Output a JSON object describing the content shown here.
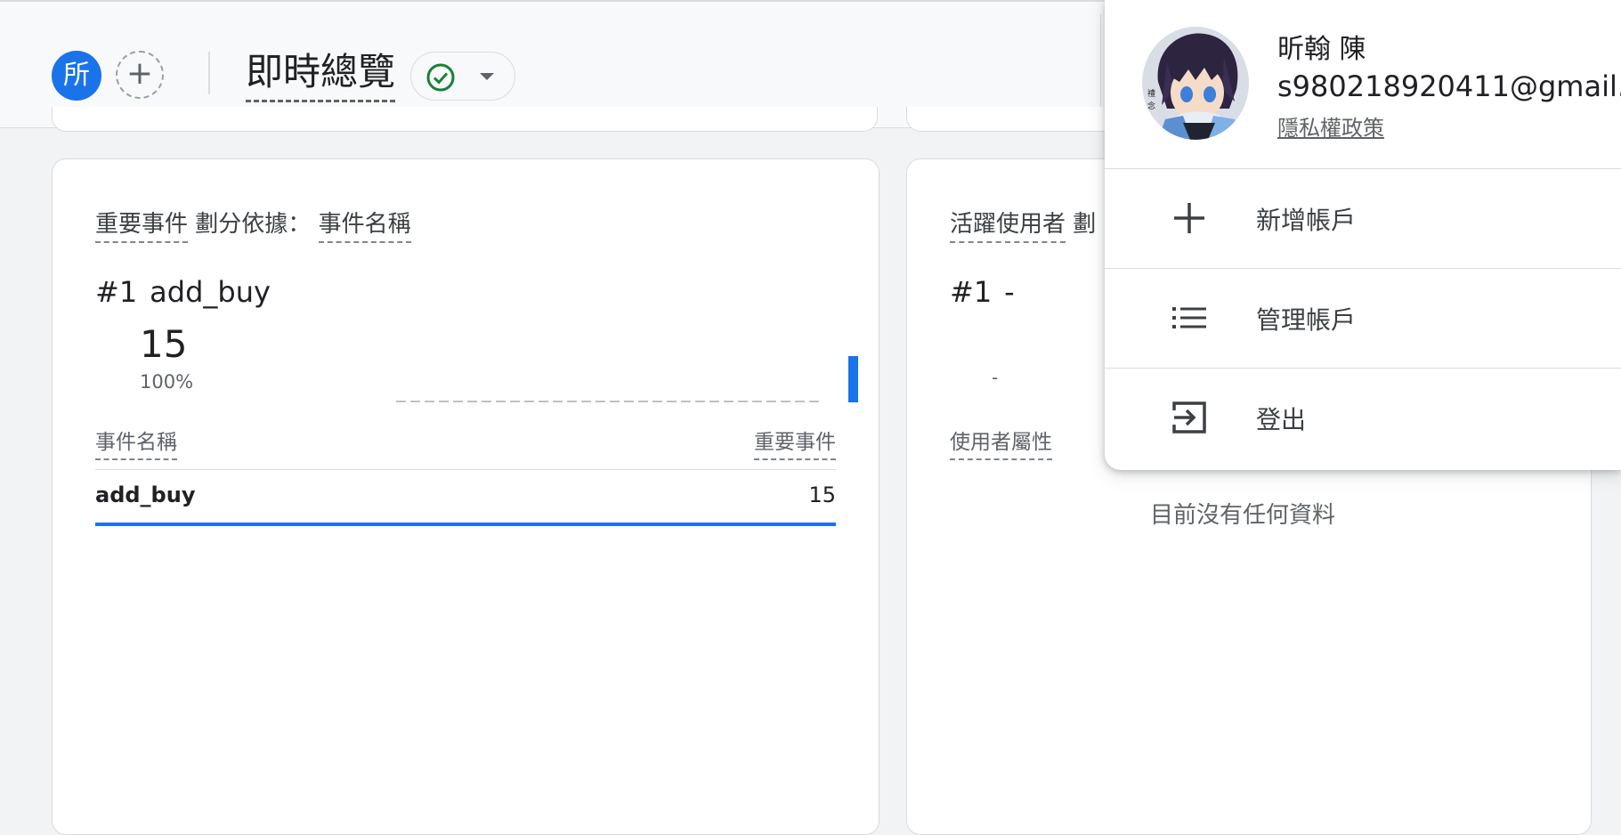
{
  "header": {
    "property_initial": "所",
    "title": "即時總覽",
    "status_ok": true,
    "accent": "#1a73e8",
    "status_color": "#188038"
  },
  "card_left": {
    "heading_metric": "重要事件",
    "heading_by": "劃分依據：",
    "heading_dim": "事件名稱",
    "rank": "#1",
    "rank_name": "add_buy",
    "value": "15",
    "percent": "100%",
    "col_left": "事件名稱",
    "col_right": "重要事件",
    "rows": [
      {
        "name": "add_buy",
        "value": "15"
      }
    ]
  },
  "card_right": {
    "heading_metric": "活躍使用者",
    "heading_by": "劃",
    "rank": "#1",
    "rank_name": "-",
    "value": "-",
    "col_left": "使用者屬性",
    "empty_message": "目前沒有任何資料"
  },
  "account_menu": {
    "name": "昕翰 陳",
    "email": "s980218920411@gmail...",
    "privacy_link": "隱私權政策",
    "items": [
      {
        "label": "新增帳戶",
        "icon": "plus-icon"
      },
      {
        "label": "管理帳戶",
        "icon": "list-icon"
      },
      {
        "label": "登出",
        "icon": "logout-icon"
      }
    ]
  }
}
